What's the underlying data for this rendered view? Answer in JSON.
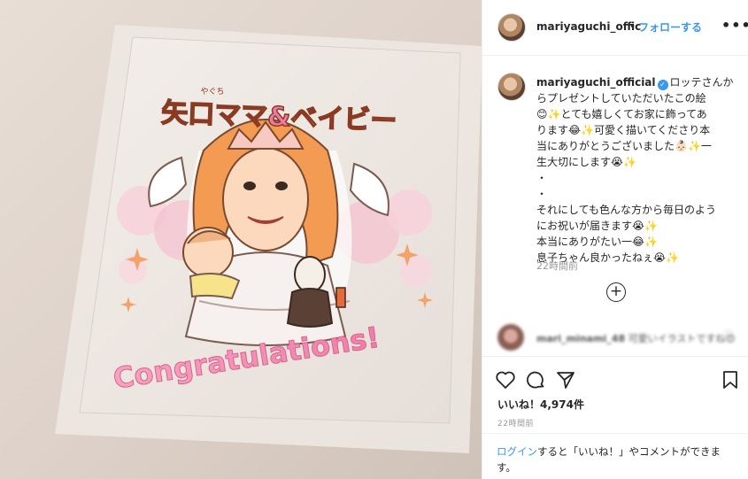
{
  "colors": {
    "accent_blue": "#3897f0",
    "text_dark": "#262626",
    "text_muted": "#999999",
    "divider": "#efefef"
  },
  "photo": {
    "card_title": "矢口ママ&ベイビー",
    "card_ruby": "やぐち",
    "card_banner": "Congratulations!"
  },
  "header": {
    "username": "mariyaguchi_offic",
    "separator": "•",
    "follow_label": "フォローする",
    "more_icon": "more-options-icon"
  },
  "caption": {
    "username": "mariyaguchi_official",
    "verified_icon": "verified-badge-icon",
    "lines": [
      "ロッテさんか",
      "らプレゼントしていただいたこの絵",
      "😊✨とても嬉しくてお家に飾ってあ",
      "ります😂✨可愛く描いてくださり本",
      "当にありがとうございました👶🏻✨一",
      "生大切にします😭✨",
      "・",
      "・",
      "それにしても色んな方から毎日のよう",
      "にお祝いが届きます😭✨",
      "本当にありがたい一😂✨",
      "息子ちゃん良かったねぇ😭✨"
    ],
    "time": "22時間前",
    "load_more_icon": "plus-circle-icon"
  },
  "comment": {
    "username": "mari_minami_48",
    "text": "可愛いイラストですね😍",
    "like_icon": "heart-small-icon"
  },
  "actions": {
    "like_icon": "heart-icon",
    "comment_icon": "comment-icon",
    "share_icon": "share-icon",
    "save_icon": "bookmark-icon",
    "likes_text": "いいね！4,974件",
    "time": "22時間前"
  },
  "login": {
    "link_text": "ログイン",
    "rest_text": "すると「いいね！」やコメントができます。"
  }
}
